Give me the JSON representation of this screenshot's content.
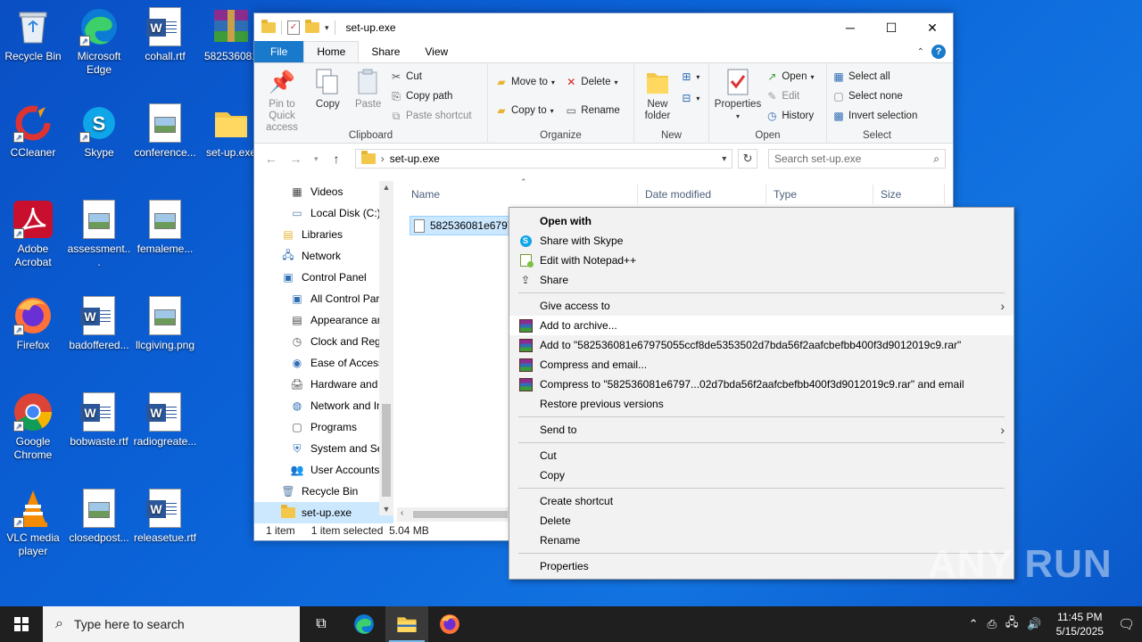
{
  "desktop": {
    "icons": [
      {
        "label": "Recycle Bin"
      },
      {
        "label": "Microsoft Edge"
      },
      {
        "label": "cohall.rtf"
      },
      {
        "label": "582536081"
      },
      {
        "label": "CCleaner"
      },
      {
        "label": "Skype"
      },
      {
        "label": "conference..."
      },
      {
        "label": "set-up.exe"
      },
      {
        "label": "Adobe Acrobat"
      },
      {
        "label": "assessment..."
      },
      {
        "label": "femaleme..."
      },
      {
        "label": "Firefox"
      },
      {
        "label": "badoffered..."
      },
      {
        "label": "llcgiving.png"
      },
      {
        "label": "Google Chrome"
      },
      {
        "label": "bobwaste.rtf"
      },
      {
        "label": "radiogreate..."
      },
      {
        "label": "VLC media player"
      },
      {
        "label": "closedpost..."
      },
      {
        "label": "releasetue.rtf"
      }
    ]
  },
  "explorer": {
    "title": "set-up.exe",
    "tabs": [
      "File",
      "Home",
      "Share",
      "View"
    ],
    "ribbon": {
      "clipboard": {
        "label": "Clipboard",
        "pin": "Pin to Quick access",
        "copy": "Copy",
        "paste": "Paste",
        "cut": "Cut",
        "copy_path": "Copy path",
        "paste_shortcut": "Paste shortcut"
      },
      "organize": {
        "label": "Organize",
        "move_to": "Move to",
        "copy_to": "Copy to",
        "delete": "Delete",
        "rename": "Rename"
      },
      "new": {
        "label": "New",
        "new_folder": "New folder"
      },
      "open": {
        "label": "Open",
        "properties": "Properties",
        "open": "Open",
        "edit": "Edit",
        "history": "History"
      },
      "select": {
        "label": "Select",
        "select_all": "Select all",
        "select_none": "Select none",
        "invert": "Invert selection"
      }
    },
    "address": {
      "path": "set-up.exe",
      "search_placeholder": "Search set-up.exe"
    },
    "nav": [
      {
        "label": "Videos"
      },
      {
        "label": "Local Disk (C:)"
      },
      {
        "label": "Libraries"
      },
      {
        "label": "Network"
      },
      {
        "label": "Control Panel"
      },
      {
        "label": "All Control Par"
      },
      {
        "label": "Appearance an"
      },
      {
        "label": "Clock and Regi"
      },
      {
        "label": "Ease of Access"
      },
      {
        "label": "Hardware and"
      },
      {
        "label": "Network and In"
      },
      {
        "label": "Programs"
      },
      {
        "label": "System and Se"
      },
      {
        "label": "User Accounts"
      },
      {
        "label": "Recycle Bin"
      },
      {
        "label": "set-up.exe"
      }
    ],
    "columns": [
      "Name",
      "Date modified",
      "Type",
      "Size"
    ],
    "file_name": "582536081e67975",
    "status": {
      "count": "1 item",
      "selected": "1 item selected",
      "size": "5.04 MB"
    }
  },
  "context_menu": {
    "open_with": "Open with",
    "share_skype": "Share with Skype",
    "edit_notepad": "Edit with Notepad++",
    "share": "Share",
    "give_access": "Give access to",
    "add_archive": "Add to archive...",
    "add_rar": "Add to \"582536081e67975055ccf8de5353502d7bda56f2aafcbefbb400f3d9012019c9.rar\"",
    "compress_email": "Compress and email...",
    "compress_rar_email": "Compress to \"582536081e6797...02d7bda56f2aafcbefbb400f3d9012019c9.rar\" and email",
    "restore": "Restore previous versions",
    "send_to": "Send to",
    "cut": "Cut",
    "copy": "Copy",
    "create_shortcut": "Create shortcut",
    "delete": "Delete",
    "rename": "Rename",
    "properties": "Properties"
  },
  "taskbar": {
    "search_placeholder": "Type here to search",
    "time": "11:45 PM",
    "date": "5/15/2025"
  },
  "watermark": "ANY RUN"
}
